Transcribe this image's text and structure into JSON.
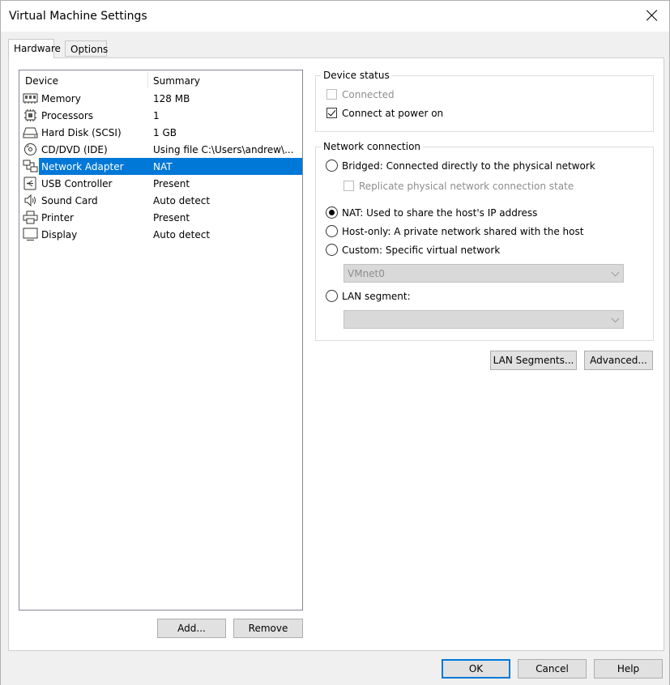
{
  "window": {
    "title": "Virtual Machine Settings"
  },
  "tabs": [
    {
      "label": "Hardware",
      "active": true
    },
    {
      "label": "Options",
      "active": false
    }
  ],
  "device_list": {
    "columns": {
      "device": "Device",
      "summary": "Summary"
    },
    "rows": [
      {
        "icon": "memory-icon",
        "device": "Memory",
        "summary": "128 MB"
      },
      {
        "icon": "processor-icon",
        "device": "Processors",
        "summary": "1"
      },
      {
        "icon": "hard-disk-icon",
        "device": "Hard Disk (SCSI)",
        "summary": "1 GB"
      },
      {
        "icon": "cd-dvd-icon",
        "device": "CD/DVD (IDE)",
        "summary": "Using file C:\\Users\\andrew\\..."
      },
      {
        "icon": "network-adapter-icon",
        "device": "Network Adapter",
        "summary": "NAT",
        "selected": true
      },
      {
        "icon": "usb-icon",
        "device": "USB Controller",
        "summary": "Present"
      },
      {
        "icon": "sound-card-icon",
        "device": "Sound Card",
        "summary": "Auto detect"
      },
      {
        "icon": "printer-icon",
        "device": "Printer",
        "summary": "Present"
      },
      {
        "icon": "display-icon",
        "device": "Display",
        "summary": "Auto detect"
      }
    ],
    "add_label": "Add...",
    "remove_label": "Remove"
  },
  "device_status": {
    "title": "Device status",
    "connected": {
      "label": "Connected",
      "checked": false,
      "enabled": false
    },
    "connect_at_power_on": {
      "label": "Connect at power on",
      "checked": true,
      "enabled": true
    }
  },
  "network_connection": {
    "title": "Network connection",
    "bridged": {
      "label": "Bridged: Connected directly to the physical network",
      "selected": false
    },
    "replicate": {
      "label": "Replicate physical network connection state",
      "checked": false,
      "enabled": false
    },
    "nat": {
      "label": "NAT: Used to share the host's IP address",
      "selected": true
    },
    "host_only": {
      "label": "Host-only: A private network shared with the host",
      "selected": false
    },
    "custom": {
      "label": "Custom: Specific virtual network",
      "selected": false
    },
    "custom_value": "VMnet0",
    "lan_segment": {
      "label": "LAN segment:",
      "selected": false
    },
    "lan_segment_value": ""
  },
  "network_buttons": {
    "lan_segments": "LAN Segments...",
    "advanced": "Advanced..."
  },
  "footer": {
    "ok": "OK",
    "cancel": "Cancel",
    "help": "Help"
  },
  "colors": {
    "selection": "#0078d7",
    "default_button_border": "#0078d7"
  }
}
